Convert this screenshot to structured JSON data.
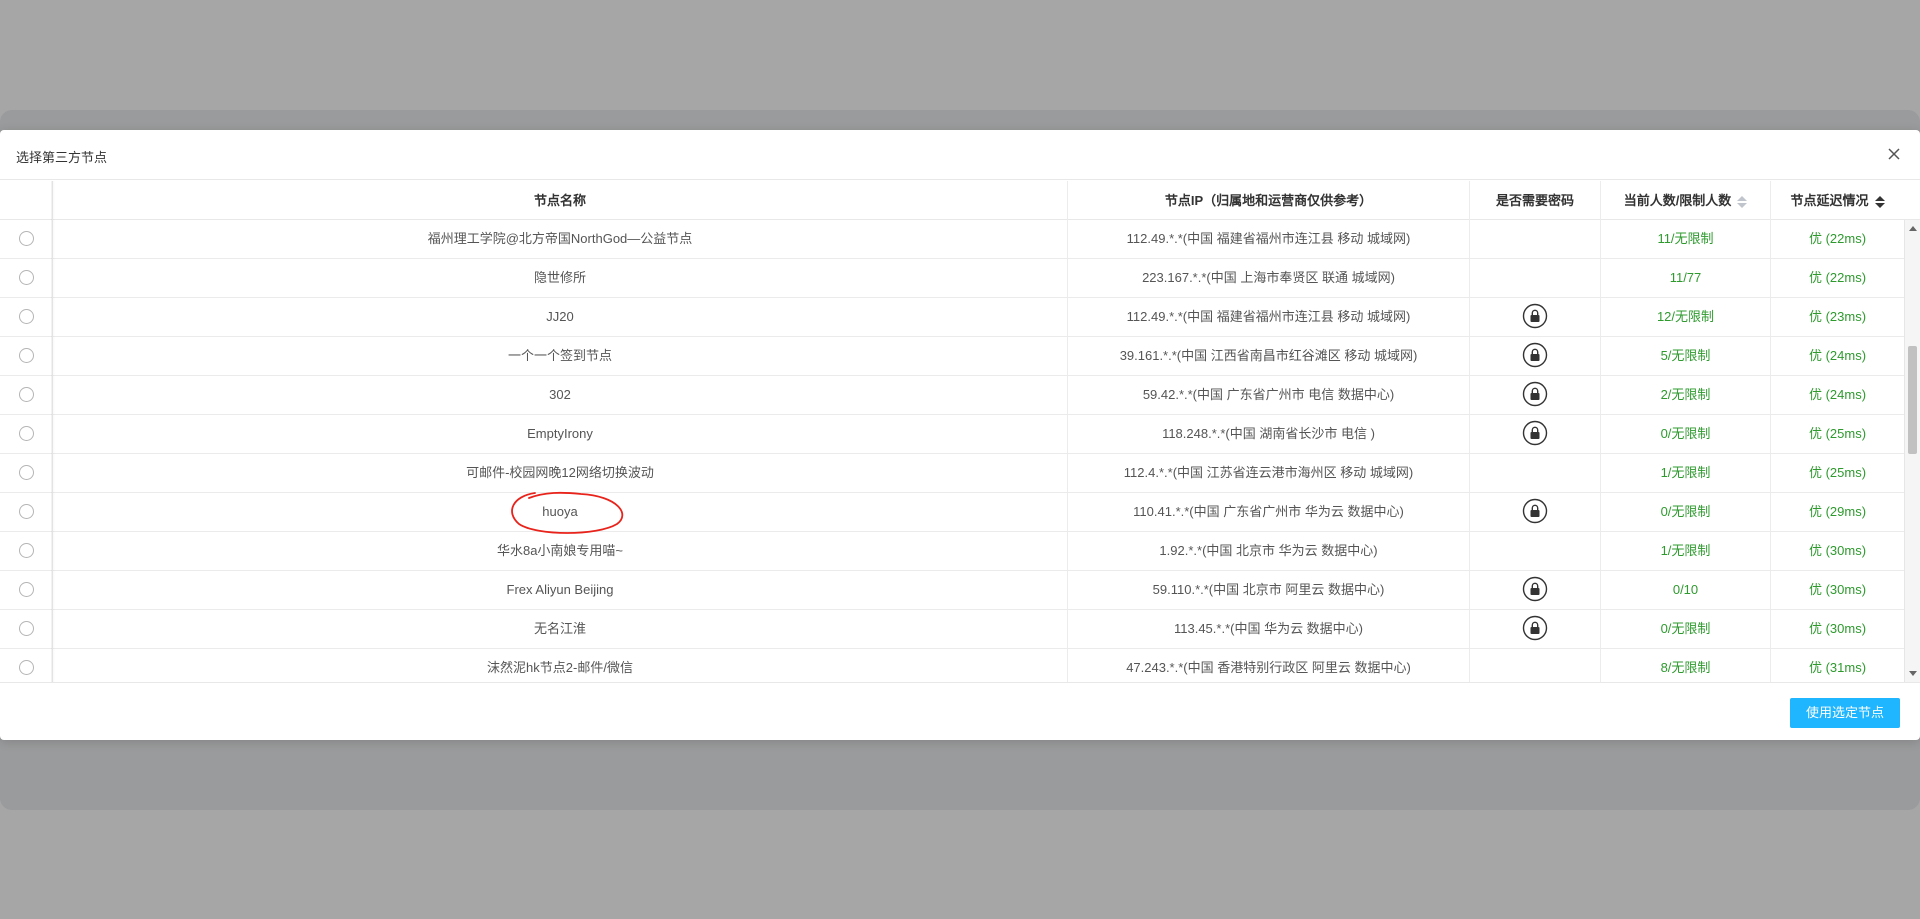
{
  "dialog": {
    "title": "选择第三方节点",
    "confirm_label": "使用选定节点"
  },
  "table": {
    "columns": [
      {
        "key": "name",
        "label": "节点名称"
      },
      {
        "key": "ip",
        "label": "节点IP（归属地和运营商仅供参考）"
      },
      {
        "key": "password",
        "label": "是否需要密码"
      },
      {
        "key": "users",
        "label": "当前人数/限制人数",
        "sortable": true,
        "sort_active": false
      },
      {
        "key": "latency",
        "label": "节点延迟情况",
        "sortable": true,
        "sort_active": true
      }
    ],
    "rows": [
      {
        "name": "福州理工学院@北方帝国NorthGod—公益节点",
        "ip": "112.49.*.*(中国 福建省福州市连江县 移动 城域网)",
        "locked": false,
        "users": "11/无限制",
        "latency": "优 (22ms)"
      },
      {
        "name": "隐世修所",
        "ip": "223.167.*.*(中国 上海市奉贤区 联通 城域网)",
        "locked": false,
        "users": "11/77",
        "latency": "优 (22ms)"
      },
      {
        "name": "JJ20",
        "ip": "112.49.*.*(中国 福建省福州市连江县 移动 城域网)",
        "locked": true,
        "users": "12/无限制",
        "latency": "优 (23ms)"
      },
      {
        "name": "一个一个签到节点",
        "ip": "39.161.*.*(中国 江西省南昌市红谷滩区 移动 城域网)",
        "locked": true,
        "users": "5/无限制",
        "latency": "优 (24ms)"
      },
      {
        "name": "302",
        "ip": "59.42.*.*(中国 广东省广州市 电信 数据中心)",
        "locked": true,
        "users": "2/无限制",
        "latency": "优 (24ms)"
      },
      {
        "name": "EmptyIrony",
        "ip": "118.248.*.*(中国 湖南省长沙市 电信 )",
        "locked": true,
        "users": "0/无限制",
        "latency": "优 (25ms)"
      },
      {
        "name": "可邮件-校园网晚12网络切换波动",
        "ip": "112.4.*.*(中国 江苏省连云港市海州区 移动 城域网)",
        "locked": false,
        "users": "1/无限制",
        "latency": "优 (25ms)"
      },
      {
        "name": "huoya",
        "ip": "110.41.*.*(中国 广东省广州市 华为云 数据中心)",
        "locked": true,
        "users": "0/无限制",
        "latency": "优 (29ms)"
      },
      {
        "name": "华水8a小南娘专用喵~",
        "ip": "1.92.*.*(中国 北京市 华为云 数据中心)",
        "locked": false,
        "users": "1/无限制",
        "latency": "优 (30ms)"
      },
      {
        "name": "Frex Aliyun Beijing",
        "ip": "59.110.*.*(中国 北京市 阿里云 数据中心)",
        "locked": true,
        "users": "0/10",
        "latency": "优 (30ms)"
      },
      {
        "name": "无名江淮",
        "ip": "113.45.*.*(中国 华为云 数据中心)",
        "locked": true,
        "users": "0/无限制",
        "latency": "优 (30ms)"
      },
      {
        "name": "沫然泥hk节点2-邮件/微信",
        "ip": "47.243.*.*(中国 香港特别行政区 阿里云 数据中心)",
        "locked": false,
        "users": "8/无限制",
        "latency": "优 (31ms)"
      }
    ]
  },
  "colors": {
    "accent": "#1fb5ff",
    "status_green": "#2e9a2e",
    "annotation_red": "#e8231b"
  },
  "icons": [
    "close-icon",
    "lock-icon",
    "sort-icon"
  ]
}
